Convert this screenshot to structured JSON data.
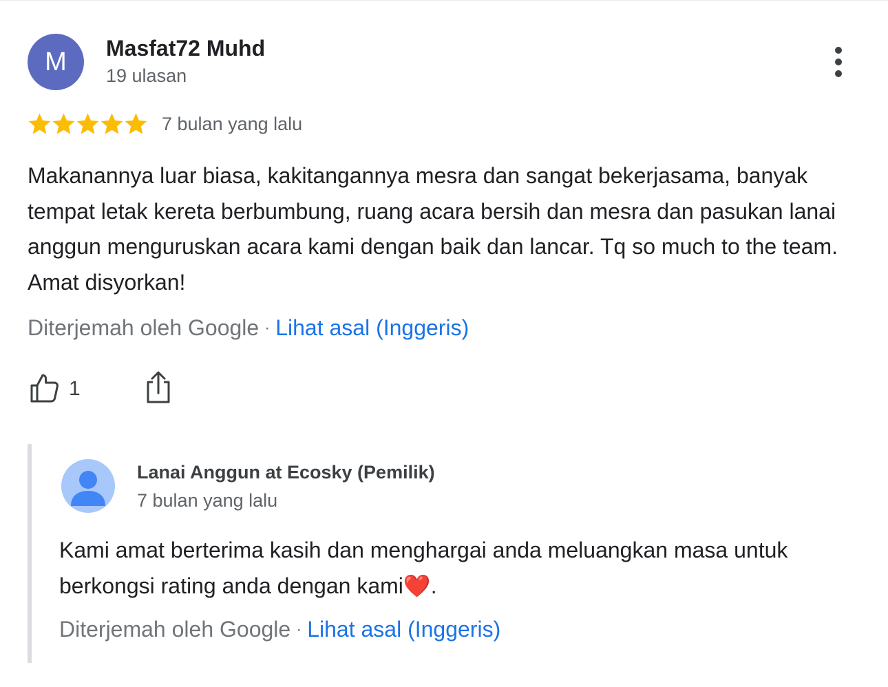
{
  "review": {
    "avatar_initial": "M",
    "avatar_color": "#5c6bc0",
    "reviewer_name": "Masfat72 Muhd",
    "review_count": "19 ulasan",
    "rating": 5,
    "rating_max": 5,
    "star_color": "#fbbc04",
    "date": "7 bulan yang lalu",
    "text": "Makanannya luar biasa, kakitangannya mesra dan sangat bekerjasama, banyak tempat letak kereta berbumbung, ruang acara bersih dan mesra dan pasukan lanai anggun menguruskan acara kami dengan baik dan lancar. Tq so much to the team. Amat disyorkan!",
    "translated_by": "Diterjemah oleh Google",
    "separator": "·",
    "see_original": "Lihat asal (Inggeris)",
    "like_count": "1",
    "icons": {
      "more": "more-vert-icon",
      "like": "thumb-up-icon",
      "share": "share-icon"
    }
  },
  "owner_reply": {
    "owner_name": "Lanai Anggun at Ecosky (Pemilik)",
    "date": "7 bulan yang lalu",
    "text": "Kami amat berterima kasih dan menghargai anda meluangkan masa untuk berkongsi rating anda dengan kami",
    "emoji": "❤️",
    "trailing": ".",
    "translated_by": "Diterjemah oleh Google",
    "separator": "·",
    "see_original": "Lihat asal (Inggeris)",
    "avatar_icon": "person-icon",
    "avatar_color": "#a8c7fa",
    "avatar_figure_color": "#4285f4"
  },
  "colors": {
    "link": "#1a73e8",
    "secondary_text": "#5f6368",
    "reply_bar": "#dadce0"
  }
}
